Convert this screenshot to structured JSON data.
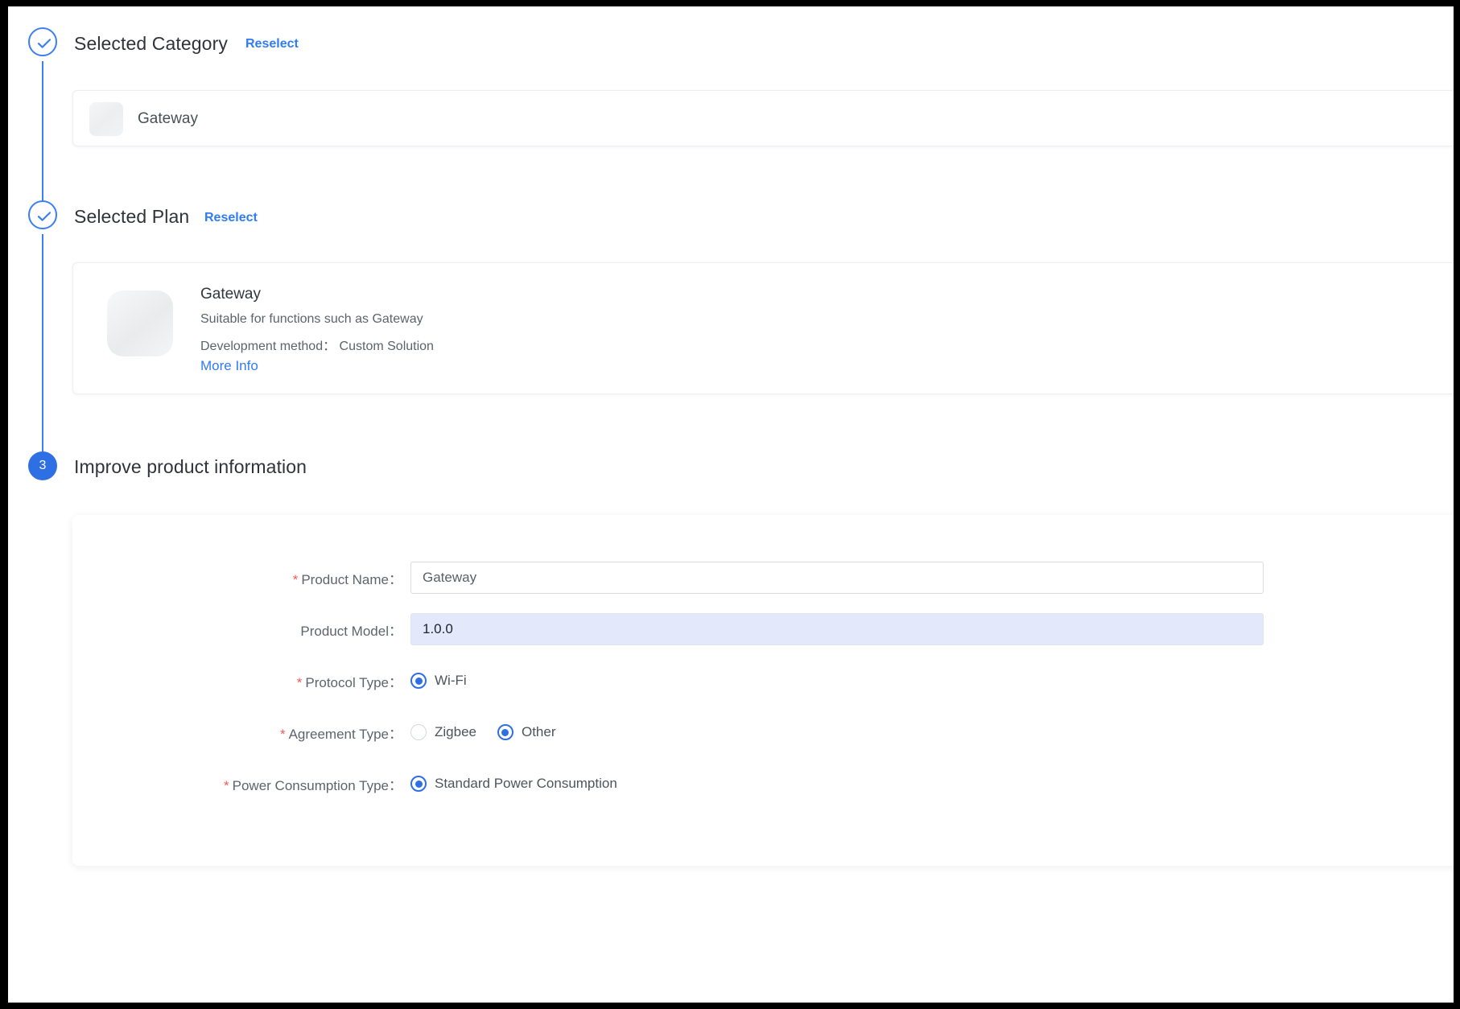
{
  "steps": [
    {
      "id": "selected-category",
      "marker": "check",
      "title": "Selected Category",
      "action_label": "Reselect"
    },
    {
      "id": "selected-plan",
      "marker": "check",
      "title": "Selected Plan",
      "action_label": "Reselect"
    },
    {
      "id": "improve-product-information",
      "marker": "3",
      "title": "Improve product information",
      "action_label": ""
    }
  ],
  "category_card": {
    "name": "Gateway",
    "icon": "product-thumbnail"
  },
  "plan_card": {
    "title": "Gateway",
    "description": "Suitable for functions such as Gateway",
    "development_method_label": "Development method：",
    "development_method_value": "Custom Solution",
    "more_info_label": "More Info",
    "icon": "plan-thumbnail"
  },
  "form": {
    "fields": [
      {
        "key": "product-name",
        "required": true,
        "label": "Product Name：",
        "type": "text",
        "value": "Gateway",
        "placeholder": "",
        "highlighted": false
      },
      {
        "key": "product-model",
        "required": false,
        "label": "Product Model：",
        "type": "text",
        "value": "1.0.0",
        "placeholder": "",
        "highlighted": true
      },
      {
        "key": "protocol-type",
        "required": true,
        "label": "Protocol Type：",
        "type": "radio",
        "options": [
          {
            "label": "Wi-Fi",
            "checked": true
          }
        ]
      },
      {
        "key": "agreement-type",
        "required": true,
        "label": "Agreement Type：",
        "type": "radio",
        "options": [
          {
            "label": "Zigbee",
            "checked": false
          },
          {
            "label": "Other",
            "checked": true
          }
        ]
      },
      {
        "key": "power-consumption-type",
        "required": true,
        "label": "Power Consumption Type：",
        "type": "radio",
        "options": [
          {
            "label": "Standard Power Consumption",
            "checked": true
          }
        ]
      }
    ]
  },
  "colors": {
    "accent": "#2f6fe4",
    "link": "#2f7cf6",
    "required": "#f05a5a",
    "highlight_field": "#e4e8fb",
    "step_line": "#3b7ff5"
  }
}
